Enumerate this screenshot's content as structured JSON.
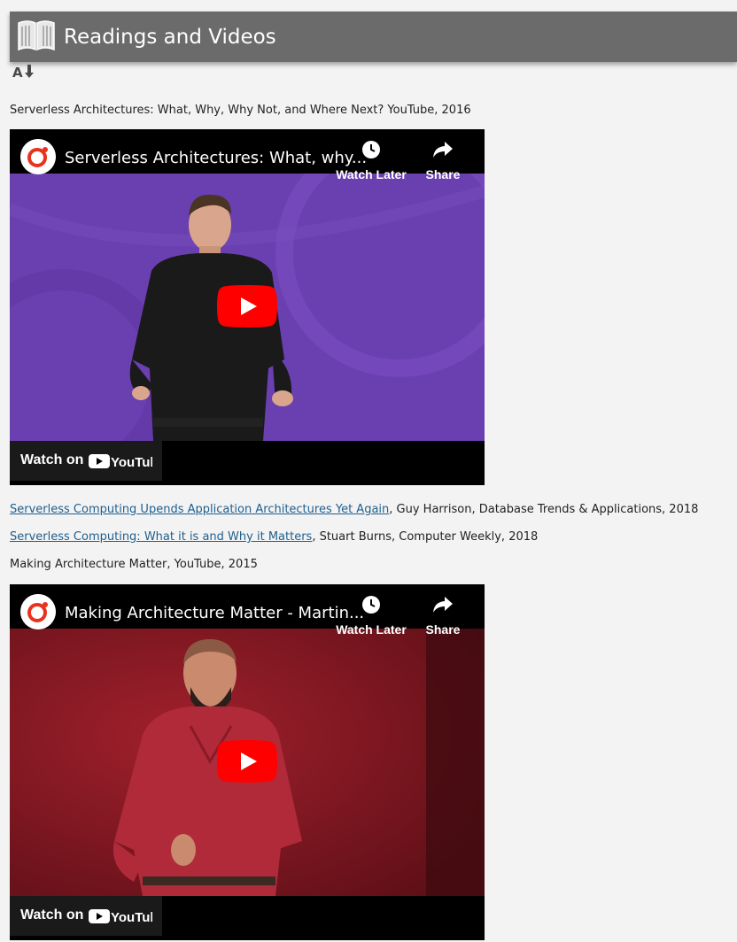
{
  "header": {
    "title": "Readings and Videos",
    "icon": "book-icon"
  },
  "sort_icon": "sort-alpha-down-icon",
  "items": [
    {
      "text": "Serverless Architectures: What, Why, Why Not, and Where Next? YouTube, 2016"
    },
    {
      "video": {
        "title": "Serverless Architectures: What, why...",
        "watch_later": "Watch Later",
        "share": "Share",
        "watch_on": "Watch on",
        "platform": "YouTube"
      }
    },
    {
      "link": "Serverless Computing Upends Application Architectures Yet Again",
      "suffix": ", Guy Harrison, Database Trends & Applications, 2018"
    },
    {
      "link": "Serverless Computing: What it is and Why it Matters",
      "suffix": ", Stuart Burns, Computer Weekly, 2018"
    },
    {
      "text": "Making Architecture Matter, YouTube, 2015"
    },
    {
      "video": {
        "title": "Making Architecture Matter - Martin...",
        "watch_later": "Watch Later",
        "share": "Share",
        "watch_on": "Watch on",
        "platform": "YouTube"
      }
    }
  ],
  "colors": {
    "header_bg": "#6b6b6b",
    "link": "#1f5f8f",
    "video1_bg": "#6a3fb0",
    "video2_bg": "#8a1a24",
    "play_red": "#ff0000"
  }
}
